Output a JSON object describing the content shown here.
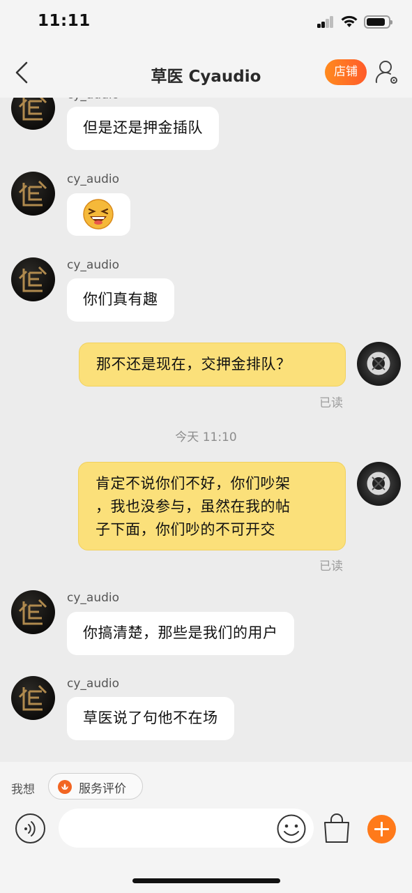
{
  "status_bar": {
    "time": "11:11"
  },
  "nav": {
    "title": "草医 Cyaudio",
    "shop_label": "店铺"
  },
  "chat": {
    "messages": [
      {
        "side": "their",
        "sender": "cy_audio",
        "text": "但是还是押金插队"
      },
      {
        "side": "their",
        "sender": "cy_audio",
        "emoji": "laughing-face"
      },
      {
        "side": "their",
        "sender": "cy_audio",
        "text": "你们真有趣"
      },
      {
        "side": "mine",
        "text": "那不还是现在，交押金排队？",
        "read": "已读"
      },
      {
        "side": "mine",
        "lines": [
          "肯定不说你们不好，你们吵架",
          "，我也没参与，虽然在我的帖",
          "子下面，你们吵的不可开交"
        ],
        "read": "已读"
      },
      {
        "side": "their",
        "sender": "cy_audio",
        "text": "你搞清楚，那些是我们的用户"
      },
      {
        "side": "their",
        "sender": "cy_audio",
        "text": "草医说了句他不在场"
      }
    ],
    "timestamp": "今天 11:10"
  },
  "bottom": {
    "quick_label": "我想",
    "service_label": "服务评价"
  },
  "colors": {
    "accent": "#ff7a1a",
    "my_bubble": "#fbe07a",
    "their_bubble": "#ffffff"
  }
}
